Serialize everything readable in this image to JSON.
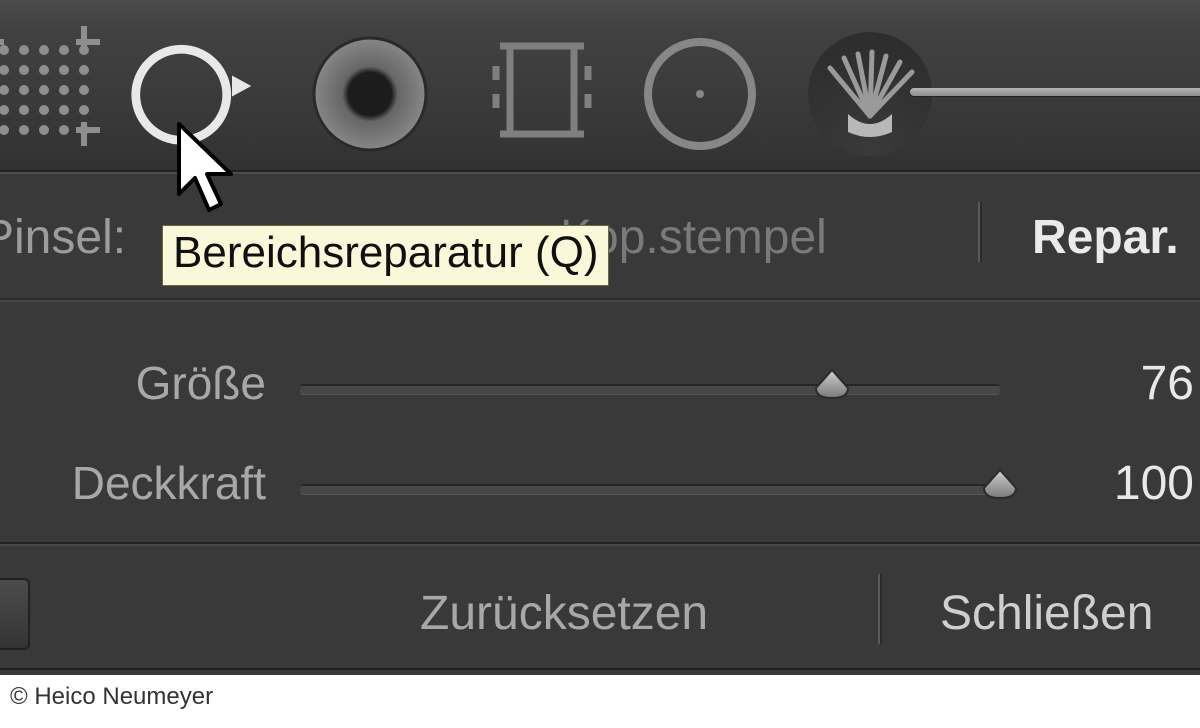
{
  "toolbar": {
    "tools": {
      "crop": {
        "name": "crop-tool"
      },
      "spot": {
        "name": "spot-removal-tool"
      },
      "redeye": {
        "name": "red-eye-tool"
      },
      "grad": {
        "name": "graduated-filter-tool"
      },
      "radial": {
        "name": "radial-filter-tool"
      },
      "brush": {
        "name": "adjustment-brush-tool"
      }
    }
  },
  "tooltip": "Bereichsreparatur (Q)",
  "mode": {
    "brush_label": "Pinsel:",
    "clone_label": "Kop.stempel",
    "heal_label": "Repar."
  },
  "sliders": {
    "size": {
      "label": "Größe",
      "value": "76",
      "percent": 76
    },
    "opacity": {
      "label": "Deckkraft",
      "value": "100",
      "percent": 100
    }
  },
  "footer": {
    "reset": "Zurücksetzen",
    "close": "Schließen"
  },
  "credit": "© Heico Neumeyer"
}
